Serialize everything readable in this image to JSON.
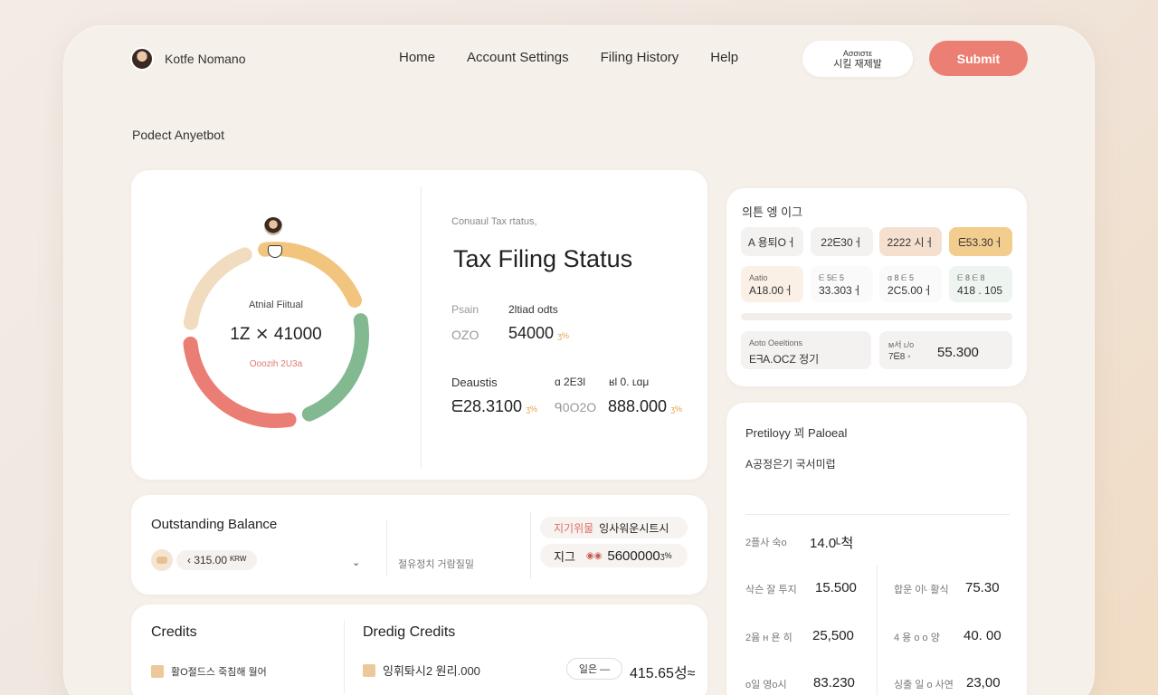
{
  "header": {
    "user_name": "Kotfe Nomano",
    "nav": [
      "Home",
      "Account Settings",
      "Filing History",
      "Help"
    ],
    "lang_line1": "Aσσιστε",
    "lang_line2": "시킬 재제발",
    "submit_label": "Submit"
  },
  "page_title": "Podect Anyetbot",
  "status_card": {
    "ring_label": "Atnial Fiitual",
    "ring_value": "1Z ⨯ 41000",
    "ring_sub": "Ooozih 2U3a",
    "current_status": "Conuaul Tax rtatus,",
    "title": "Tax Filing Status",
    "label_a": "Psain",
    "label_b": "2ltiad odts",
    "value_a": "OZO",
    "value_b": "54000",
    "value_b_suffix": "ʒ%",
    "deductions_label": "Deaustis",
    "label_c": "ɑ 2Ε3l",
    "label_d": "ʁl  0. ʟɑμ",
    "value_c": "ᗴ28.3100",
    "value_c_suffix": "ʒ%",
    "value_d": "ᑫ0O2O",
    "value_e": "888.000",
    "value_e_suffix": "ʒ%",
    "ring_segments": [
      {
        "color": "#f1dcc0",
        "share": 0.19
      },
      {
        "color": "#f2c57e",
        "share": 0.23
      },
      {
        "color": "#82b991",
        "share": 0.24
      },
      {
        "color": "#ea7d74",
        "share": 0.29
      }
    ]
  },
  "outstanding": {
    "title": "Outstanding Balance",
    "chip": "‹  315.00  ᴷᴿᵂ",
    "mid_text": "절유정치 거람질밀",
    "pill1_red": "지기위물",
    "pill1_text": "잉사워운시트시",
    "pill2_lead": "지그",
    "pill2_eyes": "◉◉",
    "pill2_big": "5600000",
    "pill2_sm": "ʒ%"
  },
  "credits": {
    "title": "Credits",
    "title2": "Dredig Credits",
    "row1": "활O절드스 죽침해 월어",
    "row2": "잉휘톼시2 원리.000",
    "chip": "일은  —",
    "amount": "415.65성≈"
  },
  "right_top": {
    "title": "의튼 엥 이그",
    "tiles_row1": [
      "A 용퇴Oㅓ",
      "22ᗴ30ㅓ",
      "2222 시ㅓ",
      "ᗴ53.30ㅓ"
    ],
    "tiles_row2": [
      {
        "top": "Aatio",
        "bottom": "A18.00ㅓ"
      },
      {
        "top": "ᗴ 5ᗴ 5",
        "bottom": "33.303ㅓ"
      },
      {
        "top": "ɑ 8 ᗴ 5",
        "bottom": "2C5.00ㅓ"
      },
      {
        "top": "ᗴ 8 ᗴ 8",
        "bottom": "418 . 105"
      }
    ],
    "box1_top": "Aoto Oeeltions",
    "box1_bottom": "EᖷA.OCZ 정기",
    "box2_top": "ᴍ서  ʟ/ᴏ",
    "box2_mid": "7ᗴ8 ◦",
    "box2_big": "55.300"
  },
  "right_bottom": {
    "title": "Pretiloγy 꾀 Paloeal",
    "subtitle": "A공정은기 국서미럽",
    "first_label": "2플사  숙ᴏ",
    "first_value": "14.0ᴸ척",
    "rows": [
      {
        "l1": "삭슨  잘 투지",
        "v1": "15.500",
        "l2": "합운  이ᴸ 활식",
        "v2": "75.30"
      },
      {
        "l1": "2윰  ʜ 욘 히",
        "v1": "25,500",
        "l2": "4  용 ᴏ ᴏ 양",
        "v2": "40. 00"
      },
      {
        "l1": "ᴏ일  영ᴏ시",
        "v1": "83.230",
        "l2": "싱출  일 ᴏ 사연",
        "v2": "23,00"
      }
    ]
  }
}
